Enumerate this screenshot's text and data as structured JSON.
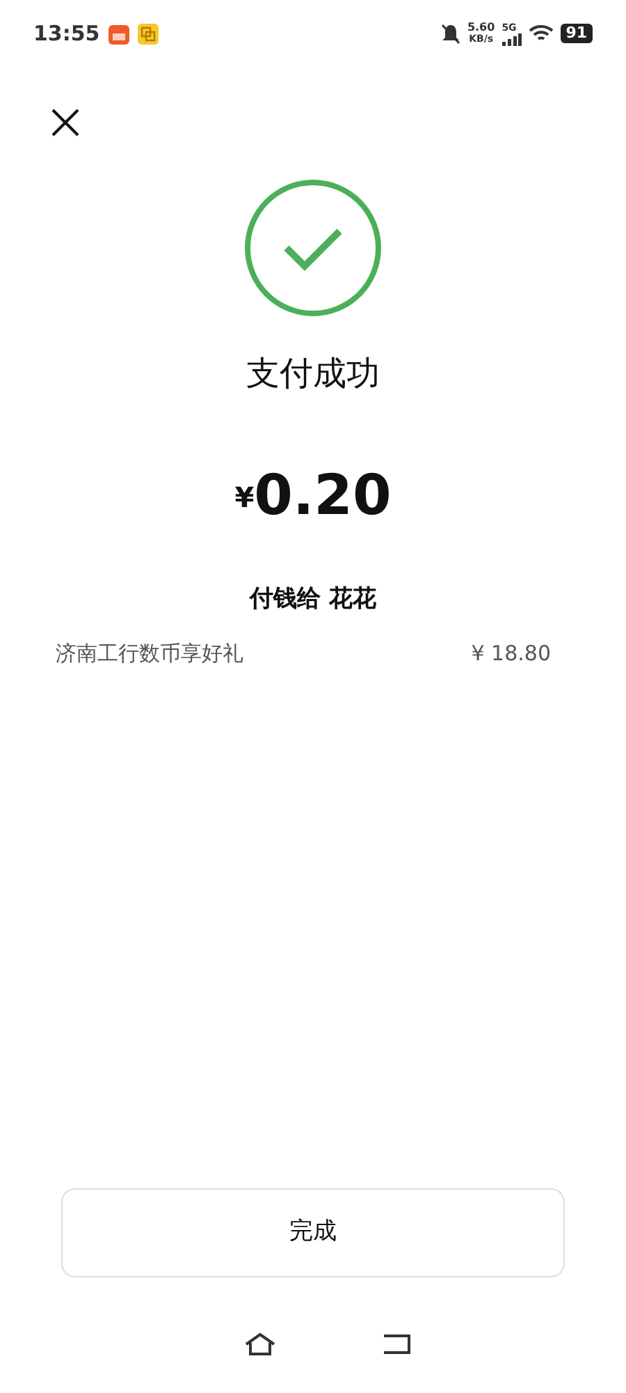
{
  "status_bar": {
    "time": "13:55",
    "network_speed": "5.60",
    "network_unit": "KB/s",
    "network_type": "5G",
    "battery": "91"
  },
  "result": {
    "title": "支付成功",
    "currency": "¥",
    "amount": "0.20",
    "payee": "付钱给 花花"
  },
  "items": [
    {
      "name": "济南工行数币享好礼",
      "price": "¥ 18.80"
    }
  ],
  "done_button": "完成"
}
